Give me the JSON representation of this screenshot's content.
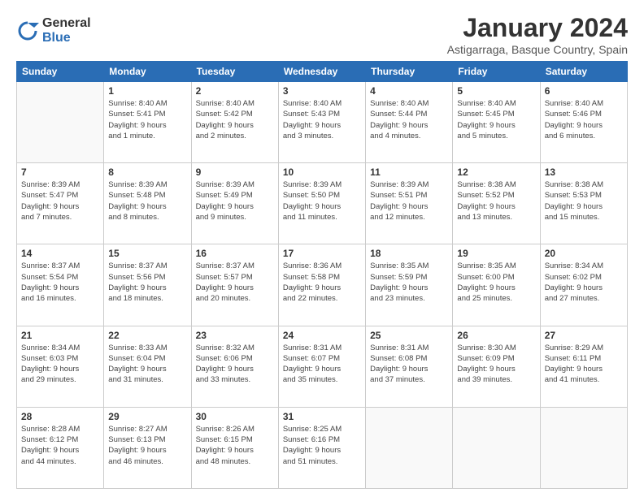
{
  "logo": {
    "general": "General",
    "blue": "Blue"
  },
  "title": "January 2024",
  "subtitle": "Astigarraga, Basque Country, Spain",
  "header_days": [
    "Sunday",
    "Monday",
    "Tuesday",
    "Wednesday",
    "Thursday",
    "Friday",
    "Saturday"
  ],
  "weeks": [
    [
      {
        "num": "",
        "detail": ""
      },
      {
        "num": "1",
        "detail": "Sunrise: 8:40 AM\nSunset: 5:41 PM\nDaylight: 9 hours\nand 1 minute."
      },
      {
        "num": "2",
        "detail": "Sunrise: 8:40 AM\nSunset: 5:42 PM\nDaylight: 9 hours\nand 2 minutes."
      },
      {
        "num": "3",
        "detail": "Sunrise: 8:40 AM\nSunset: 5:43 PM\nDaylight: 9 hours\nand 3 minutes."
      },
      {
        "num": "4",
        "detail": "Sunrise: 8:40 AM\nSunset: 5:44 PM\nDaylight: 9 hours\nand 4 minutes."
      },
      {
        "num": "5",
        "detail": "Sunrise: 8:40 AM\nSunset: 5:45 PM\nDaylight: 9 hours\nand 5 minutes."
      },
      {
        "num": "6",
        "detail": "Sunrise: 8:40 AM\nSunset: 5:46 PM\nDaylight: 9 hours\nand 6 minutes."
      }
    ],
    [
      {
        "num": "7",
        "detail": "Sunrise: 8:39 AM\nSunset: 5:47 PM\nDaylight: 9 hours\nand 7 minutes."
      },
      {
        "num": "8",
        "detail": "Sunrise: 8:39 AM\nSunset: 5:48 PM\nDaylight: 9 hours\nand 8 minutes."
      },
      {
        "num": "9",
        "detail": "Sunrise: 8:39 AM\nSunset: 5:49 PM\nDaylight: 9 hours\nand 9 minutes."
      },
      {
        "num": "10",
        "detail": "Sunrise: 8:39 AM\nSunset: 5:50 PM\nDaylight: 9 hours\nand 11 minutes."
      },
      {
        "num": "11",
        "detail": "Sunrise: 8:39 AM\nSunset: 5:51 PM\nDaylight: 9 hours\nand 12 minutes."
      },
      {
        "num": "12",
        "detail": "Sunrise: 8:38 AM\nSunset: 5:52 PM\nDaylight: 9 hours\nand 13 minutes."
      },
      {
        "num": "13",
        "detail": "Sunrise: 8:38 AM\nSunset: 5:53 PM\nDaylight: 9 hours\nand 15 minutes."
      }
    ],
    [
      {
        "num": "14",
        "detail": "Sunrise: 8:37 AM\nSunset: 5:54 PM\nDaylight: 9 hours\nand 16 minutes."
      },
      {
        "num": "15",
        "detail": "Sunrise: 8:37 AM\nSunset: 5:56 PM\nDaylight: 9 hours\nand 18 minutes."
      },
      {
        "num": "16",
        "detail": "Sunrise: 8:37 AM\nSunset: 5:57 PM\nDaylight: 9 hours\nand 20 minutes."
      },
      {
        "num": "17",
        "detail": "Sunrise: 8:36 AM\nSunset: 5:58 PM\nDaylight: 9 hours\nand 22 minutes."
      },
      {
        "num": "18",
        "detail": "Sunrise: 8:35 AM\nSunset: 5:59 PM\nDaylight: 9 hours\nand 23 minutes."
      },
      {
        "num": "19",
        "detail": "Sunrise: 8:35 AM\nSunset: 6:00 PM\nDaylight: 9 hours\nand 25 minutes."
      },
      {
        "num": "20",
        "detail": "Sunrise: 8:34 AM\nSunset: 6:02 PM\nDaylight: 9 hours\nand 27 minutes."
      }
    ],
    [
      {
        "num": "21",
        "detail": "Sunrise: 8:34 AM\nSunset: 6:03 PM\nDaylight: 9 hours\nand 29 minutes."
      },
      {
        "num": "22",
        "detail": "Sunrise: 8:33 AM\nSunset: 6:04 PM\nDaylight: 9 hours\nand 31 minutes."
      },
      {
        "num": "23",
        "detail": "Sunrise: 8:32 AM\nSunset: 6:06 PM\nDaylight: 9 hours\nand 33 minutes."
      },
      {
        "num": "24",
        "detail": "Sunrise: 8:31 AM\nSunset: 6:07 PM\nDaylight: 9 hours\nand 35 minutes."
      },
      {
        "num": "25",
        "detail": "Sunrise: 8:31 AM\nSunset: 6:08 PM\nDaylight: 9 hours\nand 37 minutes."
      },
      {
        "num": "26",
        "detail": "Sunrise: 8:30 AM\nSunset: 6:09 PM\nDaylight: 9 hours\nand 39 minutes."
      },
      {
        "num": "27",
        "detail": "Sunrise: 8:29 AM\nSunset: 6:11 PM\nDaylight: 9 hours\nand 41 minutes."
      }
    ],
    [
      {
        "num": "28",
        "detail": "Sunrise: 8:28 AM\nSunset: 6:12 PM\nDaylight: 9 hours\nand 44 minutes."
      },
      {
        "num": "29",
        "detail": "Sunrise: 8:27 AM\nSunset: 6:13 PM\nDaylight: 9 hours\nand 46 minutes."
      },
      {
        "num": "30",
        "detail": "Sunrise: 8:26 AM\nSunset: 6:15 PM\nDaylight: 9 hours\nand 48 minutes."
      },
      {
        "num": "31",
        "detail": "Sunrise: 8:25 AM\nSunset: 6:16 PM\nDaylight: 9 hours\nand 51 minutes."
      },
      {
        "num": "",
        "detail": ""
      },
      {
        "num": "",
        "detail": ""
      },
      {
        "num": "",
        "detail": ""
      }
    ]
  ]
}
